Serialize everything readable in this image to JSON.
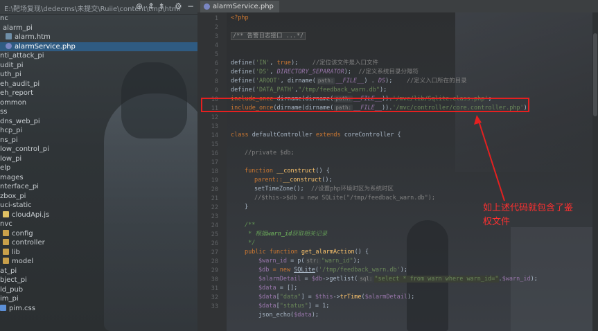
{
  "project_panel": {
    "path_text": "E:\\靶场复现\\dedecms\\未提交\\Ruiie\\content\\tmp\\html",
    "toolbar_icons": [
      "locate-icon",
      "collapse-icon",
      "expand-icon",
      "gear-icon",
      "hide-icon"
    ],
    "items": [
      {
        "label": "nc",
        "icon": "folder"
      },
      {
        "label": "alarm_pi",
        "icon": "folder"
      },
      {
        "label": "alarm.htm",
        "icon": "file"
      },
      {
        "label": "alarmService.php",
        "icon": "php",
        "selected": true
      },
      {
        "label": "nti_attack_pi",
        "icon": "folder"
      },
      {
        "label": "udit_pi",
        "icon": "folder"
      },
      {
        "label": "uth_pi",
        "icon": "folder"
      },
      {
        "label": "eh_audit_pi",
        "icon": "folder"
      },
      {
        "label": "eh_report",
        "icon": "folder"
      },
      {
        "label": "ommon",
        "icon": "folder"
      },
      {
        "label": "ss",
        "icon": "folder"
      },
      {
        "label": "dns_web_pi",
        "icon": "folder"
      },
      {
        "label": "hcp_pi",
        "icon": "folder"
      },
      {
        "label": "ns_pi",
        "icon": "folder"
      },
      {
        "label": "low_control_pi",
        "icon": "folder"
      },
      {
        "label": "low_pi",
        "icon": "folder"
      },
      {
        "label": "elp",
        "icon": "folder"
      },
      {
        "label": "mages",
        "icon": "folder"
      },
      {
        "label": "nterface_pi",
        "icon": "folder"
      },
      {
        "label": "zbox_pi",
        "icon": "folder"
      },
      {
        "label": "uci-static",
        "icon": "folder"
      },
      {
        "label": "cloudApi.js",
        "icon": "js"
      },
      {
        "label": "nvc",
        "icon": "folder"
      },
      {
        "label": "config",
        "icon": "folder"
      },
      {
        "label": "controller",
        "icon": "folder"
      },
      {
        "label": "lib",
        "icon": "folder"
      },
      {
        "label": "model",
        "icon": "folder"
      },
      {
        "label": "at_pi",
        "icon": "folder"
      },
      {
        "label": "bject_pi",
        "icon": "folder"
      },
      {
        "label": "ld_pub",
        "icon": "folder"
      },
      {
        "label": "im_pi",
        "icon": "folder"
      },
      {
        "label": "pim.css",
        "icon": "css"
      }
    ]
  },
  "editor": {
    "tab_label": "alarmService.php",
    "line_numbers": [
      "1",
      "2",
      "3",
      "4",
      "5",
      "6",
      "7",
      "8",
      "9",
      "10",
      "11",
      "12",
      "13",
      "14",
      "15",
      "16",
      "17",
      "18",
      "19",
      "20",
      "21",
      "22",
      "23",
      "24",
      "25",
      "26",
      "27",
      "28",
      "29",
      "30",
      "31",
      "32",
      "33"
    ],
    "hints": {
      "path": "path:",
      "str": "str:",
      "sql": "sql:"
    },
    "code": {
      "l1": "<?php",
      "l3_fold": "/** 告警日志接口 ...*/",
      "l6a": "define(",
      "l6b": "'IN'",
      "l6c": ", ",
      "l6d": "true",
      "l6e": ");",
      "l6f": "    //定位该文件是入口文件",
      "l7a": "define(",
      "l7b": "'DS'",
      "l7c": ", ",
      "l7d": "DIRECTORY_SEPARATOR",
      "l7e": ");",
      "l7f": "  //定义系统目录分隔符",
      "l8a": "define(",
      "l8b": "'AROOT'",
      "l8c": ", dirname(",
      "l8d": "__FILE__",
      "l8e": ") . ",
      "l8f": "DS",
      "l8g": ");",
      "l8h": "    //定义入口所在的目录",
      "l9a": "define(",
      "l9b": "'DATA_PATH'",
      "l9c": ",",
      "l9d": "\"/tmp/feedback_warn.db\"",
      "l9e": ");",
      "l10a": "include_once ",
      "l10b": "dirname(dirname(",
      "l10c": "__FILE__",
      "l10d": ")).",
      "l10e": "'/mvc/lib/Sqlite.class.php'",
      "l10f": ";",
      "l11a": "include_once",
      "l11b": "(dirname(dirname(",
      "l11c": "__FILE__",
      "l11d": ")).",
      "l11e": "'/mvc/controller/core.controller.php'",
      "l11f": ");",
      "l13a": "class ",
      "l13b": "defaultController ",
      "l13c": "extends ",
      "l13d": "coreController {",
      "l15": "//private $db;",
      "l17a": "function ",
      "l17b": "__construct",
      "l17c": "() {",
      "l18a": "parent::",
      "l18b": "__construct",
      "l18c": "();",
      "l19a": "setTimeZone();",
      "l19b": "  //设置php环境时区为系统时区",
      "l20": "//$this->$db = new SQLite(\"/tmp/feedback_warn.db\");",
      "l21": "}",
      "l23": "/**",
      "l24a": " * 根据",
      "l24b": "warn_id",
      "l24c": "获取相关记录",
      "l25": " */",
      "l26a": "public function ",
      "l26b": "get_alarmAction",
      "l26c": "() {",
      "l27a": "$warn_id",
      "l27b": " = p(",
      "l27c": "\"warn_id\"",
      "l27d": ");",
      "l28a": "$db",
      "l28b": " = new ",
      "l28c": "SQLite",
      "l28d": "(",
      "l28e": "'/tmp/feedback_warn.db'",
      "l28f": ");",
      "l29a": "$alarmDetail",
      "l29b": " = ",
      "l29c": "$db",
      "l29d": "->getlist(",
      "l29e": "\"select * from warn where warn_id=\"",
      "l29f": ".",
      "l29g": "$warn_id",
      "l29h": ");",
      "l30a": "$data",
      "l30b": " = [];",
      "l31a": "$data",
      "l31b": "[",
      "l31c": "\"data\"",
      "l31d": "] = ",
      "l31e": "$this",
      "l31f": "->",
      "l31g": "trTime",
      "l31h": "(",
      "l31i": "$alarmDetail",
      "l31j": ");",
      "l32a": "$data",
      "l32b": "[",
      "l32c": "\"status\"",
      "l32d": "] = 1;",
      "l33a": "json_echo(",
      "l33b": "$data",
      "l33c": ");"
    }
  },
  "annotation": {
    "text_line1": "如上述代码就包含了鉴",
    "text_line2": "权文件",
    "color": "#ff3030"
  }
}
